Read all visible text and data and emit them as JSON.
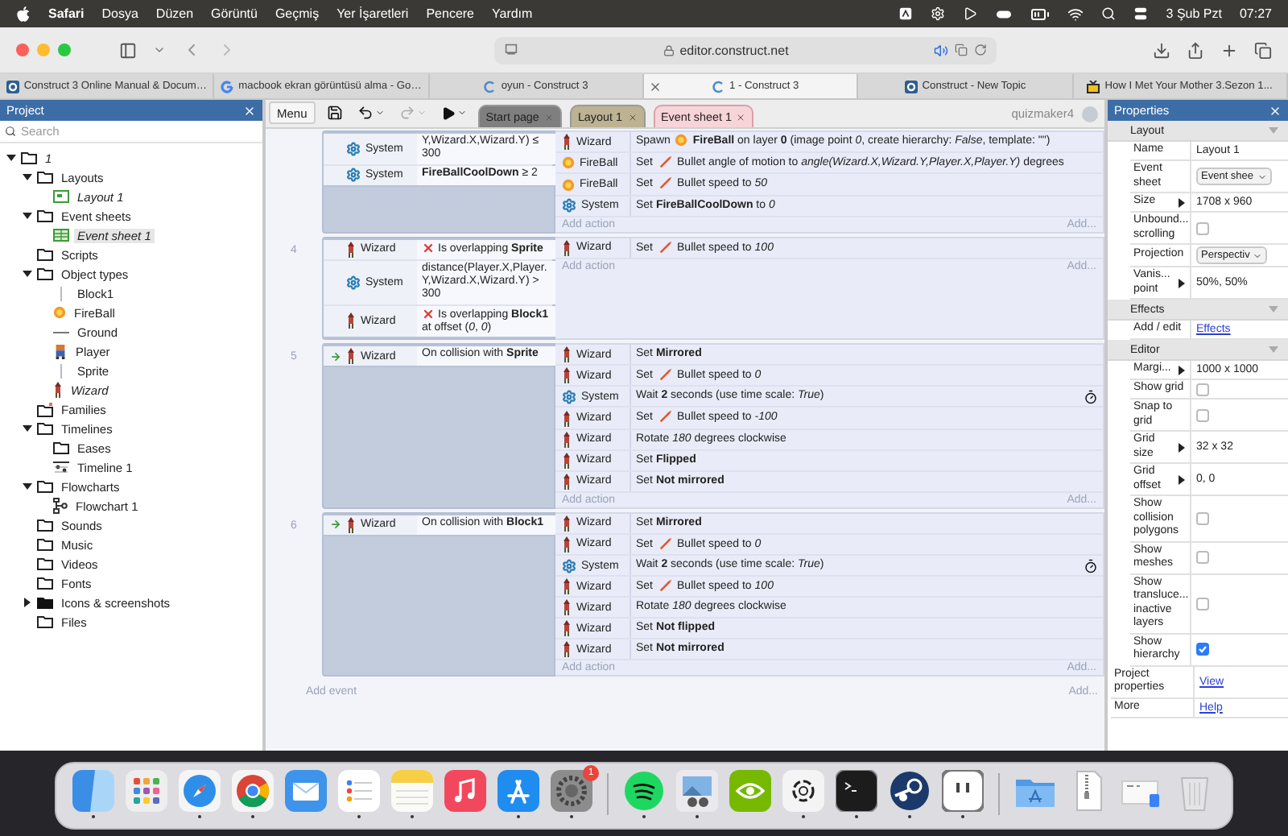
{
  "menu_bar": {
    "app": "Safari",
    "items": [
      "Dosya",
      "Düzen",
      "Görüntü",
      "Geçmiş",
      "Yer İşaretleri",
      "Pencere",
      "Yardım"
    ],
    "date": "3 Şub Pzt",
    "time": "07:27"
  },
  "browser": {
    "address": "editor.construct.net",
    "tabs": [
      {
        "title": "Construct 3 Online Manual & Docum…",
        "kind": "site",
        "selected": false
      },
      {
        "title": "macbook ekran görüntüsü alma - Go…",
        "kind": "search",
        "selected": false
      },
      {
        "title": "oyun - Construct 3",
        "kind": "loading",
        "selected": false
      },
      {
        "title": "1 - Construct 3",
        "kind": "loading",
        "selected": true
      },
      {
        "title": "Construct - New Topic",
        "kind": "site",
        "selected": false
      },
      {
        "title": "How I Met Your Mother 3.Sezon 1...",
        "kind": "video",
        "selected": false
      }
    ]
  },
  "project": {
    "title": "Project",
    "search_placeholder": "Search",
    "tree": [
      {
        "label": "1",
        "italic": true,
        "selected": false,
        "kind": "folder",
        "expanded": true,
        "children": [
          {
            "label": "Layouts",
            "italic": false,
            "selected": false,
            "kind": "folder",
            "expanded": true,
            "children": [
              {
                "label": "Layout 1",
                "italic": true,
                "selected": false,
                "kind": "layout"
              }
            ]
          },
          {
            "label": "Event sheets",
            "italic": false,
            "selected": false,
            "kind": "folder",
            "expanded": true,
            "children": [
              {
                "label": "Event sheet 1",
                "italic": true,
                "selected": true,
                "kind": "event-sheet"
              }
            ]
          },
          {
            "label": "Scripts",
            "italic": false,
            "selected": false,
            "kind": "folder"
          },
          {
            "label": "Object types",
            "italic": false,
            "selected": false,
            "kind": "folder",
            "expanded": true,
            "children": [
              {
                "label": "Block1",
                "italic": false,
                "selected": false,
                "kind": "tiled"
              },
              {
                "label": "FireBall",
                "italic": false,
                "selected": false,
                "kind": "projectile"
              },
              {
                "label": "Ground",
                "italic": false,
                "selected": false,
                "kind": "floor"
              },
              {
                "label": "Player",
                "italic": false,
                "selected": false,
                "kind": "player"
              },
              {
                "label": "Sprite",
                "italic": false,
                "selected": false,
                "kind": "tiled"
              },
              {
                "label": "Wizard",
                "italic": true,
                "selected": false,
                "kind": "character"
              }
            ]
          },
          {
            "label": "Families",
            "italic": false,
            "selected": false,
            "kind": "family"
          },
          {
            "label": "Timelines",
            "italic": false,
            "selected": false,
            "kind": "folder",
            "expanded": true,
            "children": [
              {
                "label": "Eases",
                "italic": false,
                "selected": false,
                "kind": "folder"
              },
              {
                "label": "Timeline 1",
                "italic": false,
                "selected": false,
                "kind": "timeline"
              }
            ]
          },
          {
            "label": "Flowcharts",
            "italic": false,
            "selected": false,
            "kind": "folder",
            "expanded": true,
            "children": [
              {
                "label": "Flowchart 1",
                "italic": false,
                "selected": false,
                "kind": "flowchart"
              }
            ]
          },
          {
            "label": "Sounds",
            "italic": false,
            "selected": false,
            "kind": "folder"
          },
          {
            "label": "Music",
            "italic": false,
            "selected": false,
            "kind": "folder"
          },
          {
            "label": "Videos",
            "italic": false,
            "selected": false,
            "kind": "folder"
          },
          {
            "label": "Fonts",
            "italic": false,
            "selected": false,
            "kind": "folder"
          },
          {
            "label": "Icons & screenshots",
            "italic": false,
            "selected": false,
            "kind": "media-folder",
            "expanded": false
          },
          {
            "label": "Files",
            "italic": false,
            "selected": false,
            "kind": "folder"
          }
        ]
      }
    ]
  },
  "toolbar": {
    "menu": "Menu",
    "user": "quizmaker4",
    "tabs": [
      {
        "label": "Start page",
        "color": "#7f7f7f",
        "selected": false
      },
      {
        "label": "Layout 1",
        "color": "#bdb291",
        "selected": false
      },
      {
        "label": "Event sheet 1",
        "color": "#f7d4d8",
        "selected": true
      }
    ]
  },
  "event_sheet": {
    "add_event": "Add event",
    "add_more": "Add...",
    "events": [
      {
        "trigger": false,
        "conditions": [
          {
            "object": {
              "name": "System",
              "kind": "system"
            },
            "negated": false,
            "text": "Y,Wizard.X,Wizard.Y) ≤ 300"
          },
          {
            "object": {
              "name": "System",
              "kind": "system"
            },
            "negated": false,
            "text": "**FireBallCoolDown** ≥ 2"
          }
        ],
        "actions": [
          {
            "object": {
              "name": "Wizard",
              "kind": "character"
            },
            "kind": "spawn",
            "async": false,
            "verb": "Spawn",
            "text": "**FireBall** on layer **0** (image point *0*, create hierarchy: *False*, template: \"\")"
          },
          {
            "object": {
              "name": "FireBall",
              "kind": "projectile"
            },
            "kind": "behavior",
            "async": false,
            "verb": "Set",
            "text": "Bullet angle of motion to *angle(Wizard.X,Wizard.Y,Player.X,Player.Y)*  degrees"
          },
          {
            "object": {
              "name": "FireBall",
              "kind": "projectile"
            },
            "kind": "behavior",
            "async": false,
            "verb": "Set",
            "text": "Bullet speed to *50*"
          },
          {
            "object": {
              "name": "System",
              "kind": "system"
            },
            "kind": "plain",
            "async": false,
            "text": "Set **FireBallCoolDown** to *0*"
          }
        ],
        "add_action": "Add action",
        "add_more": "Add..."
      },
      {
        "number": "4",
        "trigger": false,
        "conditions": [
          {
            "object": {
              "name": "Wizard",
              "kind": "character"
            },
            "negated": true,
            "text": "Is overlapping **Sprite**"
          },
          {
            "object": {
              "name": "System",
              "kind": "system"
            },
            "negated": false,
            "text": "distance(Player.X,Player.Y,Wizard.X,Wizard.Y)  > 300"
          },
          {
            "object": {
              "name": "Wizard",
              "kind": "character"
            },
            "negated": true,
            "text": "Is overlapping **Block1** at offset (*0*, *0*)"
          }
        ],
        "actions": [
          {
            "object": {
              "name": "Wizard",
              "kind": "character"
            },
            "kind": "behavior",
            "async": false,
            "verb": "Set",
            "text": "Bullet speed to *100*"
          }
        ],
        "add_action": "Add action",
        "add_more": "Add..."
      },
      {
        "number": "5",
        "trigger": true,
        "conditions": [
          {
            "object": {
              "name": "Wizard",
              "kind": "character"
            },
            "negated": false,
            "text": "On collision with **Sprite**"
          }
        ],
        "actions": [
          {
            "object": {
              "name": "Wizard",
              "kind": "character"
            },
            "kind": "plain",
            "async": false,
            "text": "Set **Mirrored**"
          },
          {
            "object": {
              "name": "Wizard",
              "kind": "character"
            },
            "kind": "behavior",
            "async": false,
            "verb": "Set",
            "text": "Bullet speed to *0*"
          },
          {
            "object": {
              "name": "System",
              "kind": "system"
            },
            "kind": "plain",
            "async": true,
            "text": "Wait **2** seconds (use time scale: *True*)"
          },
          {
            "object": {
              "name": "Wizard",
              "kind": "character"
            },
            "kind": "behavior",
            "async": false,
            "verb": "Set",
            "text": "Bullet speed to *-100*"
          },
          {
            "object": {
              "name": "Wizard",
              "kind": "character"
            },
            "kind": "plain",
            "async": false,
            "text": "Rotate *180* degrees clockwise"
          },
          {
            "object": {
              "name": "Wizard",
              "kind": "character"
            },
            "kind": "plain",
            "async": false,
            "text": "Set **Flipped**"
          },
          {
            "object": {
              "name": "Wizard",
              "kind": "character"
            },
            "kind": "plain",
            "async": false,
            "text": "Set **Not mirrored**"
          }
        ],
        "add_action": "Add action",
        "add_more": "Add..."
      },
      {
        "number": "6",
        "trigger": true,
        "conditions": [
          {
            "object": {
              "name": "Wizard",
              "kind": "character"
            },
            "negated": false,
            "text": "On collision with **Block1**"
          }
        ],
        "actions": [
          {
            "object": {
              "name": "Wizard",
              "kind": "character"
            },
            "kind": "plain",
            "async": false,
            "text": "Set **Mirrored**"
          },
          {
            "object": {
              "name": "Wizard",
              "kind": "character"
            },
            "kind": "behavior",
            "async": false,
            "verb": "Set",
            "text": "Bullet speed to *0*"
          },
          {
            "object": {
              "name": "System",
              "kind": "system"
            },
            "kind": "plain",
            "async": true,
            "text": "Wait **2** seconds (use time scale: *True*)"
          },
          {
            "object": {
              "name": "Wizard",
              "kind": "character"
            },
            "kind": "behavior",
            "async": false,
            "verb": "Set",
            "text": "Bullet speed to *100*"
          },
          {
            "object": {
              "name": "Wizard",
              "kind": "character"
            },
            "kind": "plain",
            "async": false,
            "text": "Rotate *180* degrees clockwise"
          },
          {
            "object": {
              "name": "Wizard",
              "kind": "character"
            },
            "kind": "plain",
            "async": false,
            "text": "Set **Not flipped**"
          },
          {
            "object": {
              "name": "Wizard",
              "kind": "character"
            },
            "kind": "plain",
            "async": false,
            "text": "Set **Not mirrored**"
          }
        ],
        "add_action": "Add action",
        "add_more": "Add..."
      }
    ]
  },
  "properties": {
    "title": "Properties",
    "sections": [
      {
        "title": "Layout",
        "expanded": true,
        "rows": [
          {
            "label": "Name",
            "kind": "text",
            "value": "Layout 1",
            "expandable": false
          },
          {
            "label": "Event sheet",
            "kind": "select",
            "value": "Event shee",
            "expandable": false
          },
          {
            "label": "Size",
            "kind": "text",
            "value": "1708 x 960",
            "expandable": true
          },
          {
            "label": "Unbound... scrolling",
            "kind": "checkbox",
            "checked": false,
            "expandable": false
          },
          {
            "label": "Projection",
            "kind": "select",
            "value": "Perspectiv",
            "expandable": false
          },
          {
            "label": "Vanis... point",
            "kind": "text",
            "value": "50%, 50%",
            "expandable": true
          }
        ]
      },
      {
        "title": "Effects",
        "expanded": true,
        "rows": [
          {
            "label": "Add / edit",
            "kind": "link",
            "value": "Effects",
            "expandable": false
          }
        ]
      },
      {
        "title": "Editor",
        "expanded": true,
        "rows": [
          {
            "label": "Margi...",
            "kind": "text",
            "value": "1000 x 1000",
            "expandable": true
          },
          {
            "label": "Show grid",
            "kind": "checkbox",
            "checked": false,
            "expandable": false
          },
          {
            "label": "Snap to grid",
            "kind": "checkbox",
            "checked": false,
            "expandable": false
          },
          {
            "label": "Grid size",
            "kind": "text",
            "value": "32 x 32",
            "expandable": true
          },
          {
            "label": "Grid offset",
            "kind": "text",
            "value": "0, 0",
            "expandable": true
          },
          {
            "label": "Show collision polygons",
            "kind": "checkbox",
            "checked": false,
            "expandable": false
          },
          {
            "label": "Show meshes",
            "kind": "checkbox",
            "checked": false,
            "expandable": false
          },
          {
            "label": "Show transluce... inactive layers",
            "kind": "checkbox",
            "checked": false,
            "expandable": false
          },
          {
            "label": "Show hierarchy",
            "kind": "checkbox",
            "checked": true,
            "expandable": false
          }
        ]
      }
    ],
    "footer_rows": [
      {
        "label": "Project properties",
        "kind": "link",
        "value": "View"
      },
      {
        "label": "More",
        "kind": "link",
        "value": "Help"
      }
    ]
  },
  "dock": {
    "apps": [
      {
        "kind": "finder",
        "running": true
      },
      {
        "kind": "launchpad",
        "running": false
      },
      {
        "kind": "safari",
        "running": true
      },
      {
        "kind": "chrome",
        "running": true
      },
      {
        "kind": "mail",
        "running": false
      },
      {
        "kind": "reminders",
        "running": true
      },
      {
        "kind": "notes",
        "running": true
      },
      {
        "kind": "music",
        "running": false
      },
      {
        "kind": "appstore",
        "running": true
      },
      {
        "kind": "settings",
        "running": true,
        "badge": "1"
      },
      {
        "kind": "separator"
      },
      {
        "kind": "spotify",
        "running": true
      },
      {
        "kind": "preview",
        "running": true
      },
      {
        "kind": "nvidia",
        "running": false
      },
      {
        "kind": "chatgpt",
        "running": true
      },
      {
        "kind": "terminal",
        "running": true
      },
      {
        "kind": "steam",
        "running": true
      },
      {
        "kind": "pixel",
        "running": true
      },
      {
        "kind": "separator"
      },
      {
        "kind": "folder",
        "running": false
      },
      {
        "kind": "zip",
        "running": false
      },
      {
        "kind": "screenshot",
        "running": false
      },
      {
        "kind": "trash",
        "running": false
      }
    ]
  }
}
